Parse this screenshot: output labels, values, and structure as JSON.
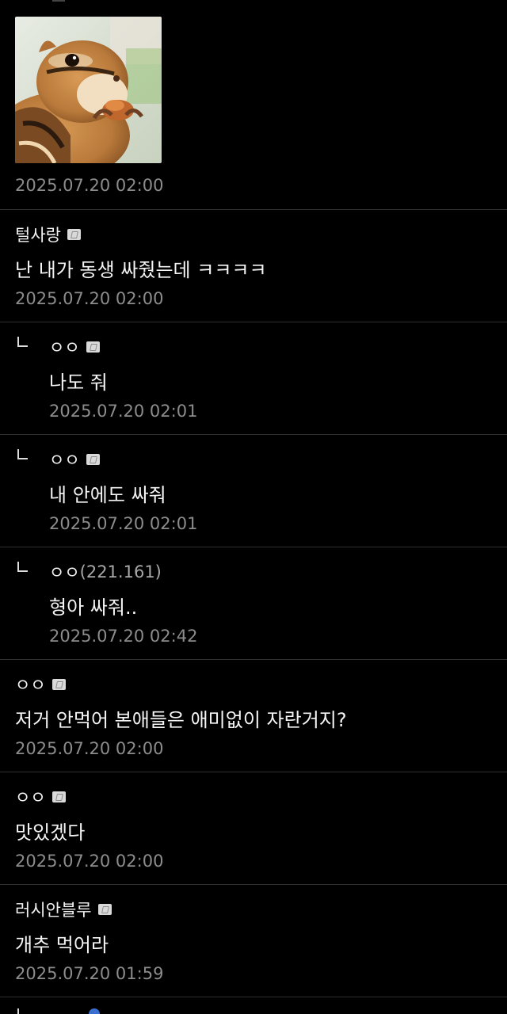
{
  "photo": {
    "subject": "chipmunk eating a nut",
    "colors": {
      "fur": "#b8793a",
      "background": "#cfd8c8"
    }
  },
  "photo_timestamp": "2025.07.20 02:00",
  "comments": [
    {
      "author": "털사랑",
      "ip": "",
      "verified": true,
      "reply": false,
      "text": "난 내가 동생 싸줬는데 ㅋㅋㅋㅋ",
      "time": "2025.07.20 02:00"
    },
    {
      "author": "ㅇㅇ",
      "ip": "",
      "verified": true,
      "reply": true,
      "text": "나도 줘",
      "time": "2025.07.20 02:01"
    },
    {
      "author": "ㅇㅇ",
      "ip": "",
      "verified": true,
      "reply": true,
      "text": "내 안에도 싸줘",
      "time": "2025.07.20 02:01"
    },
    {
      "author": "ㅇㅇ",
      "ip": "(221.161)",
      "verified": false,
      "reply": true,
      "text": "형아 싸줘..",
      "time": "2025.07.20 02:42"
    },
    {
      "author": "ㅇㅇ",
      "ip": "",
      "verified": true,
      "reply": false,
      "text": "저거 안먹어 본애들은 애미없이 자란거지?",
      "time": "2025.07.20 02:00"
    },
    {
      "author": "ㅇㅇ",
      "ip": "",
      "verified": true,
      "reply": false,
      "text": "맛있겠다",
      "time": "2025.07.20 02:00"
    },
    {
      "author": "러시안블루",
      "ip": "",
      "verified": true,
      "reply": false,
      "text": "개추 먹어라",
      "time": "2025.07.20 01:59"
    }
  ],
  "colors": {
    "background": "#000000",
    "divider": "#2f2f2f",
    "text": "#f2f2f2",
    "meta": "#8c8c8c"
  }
}
